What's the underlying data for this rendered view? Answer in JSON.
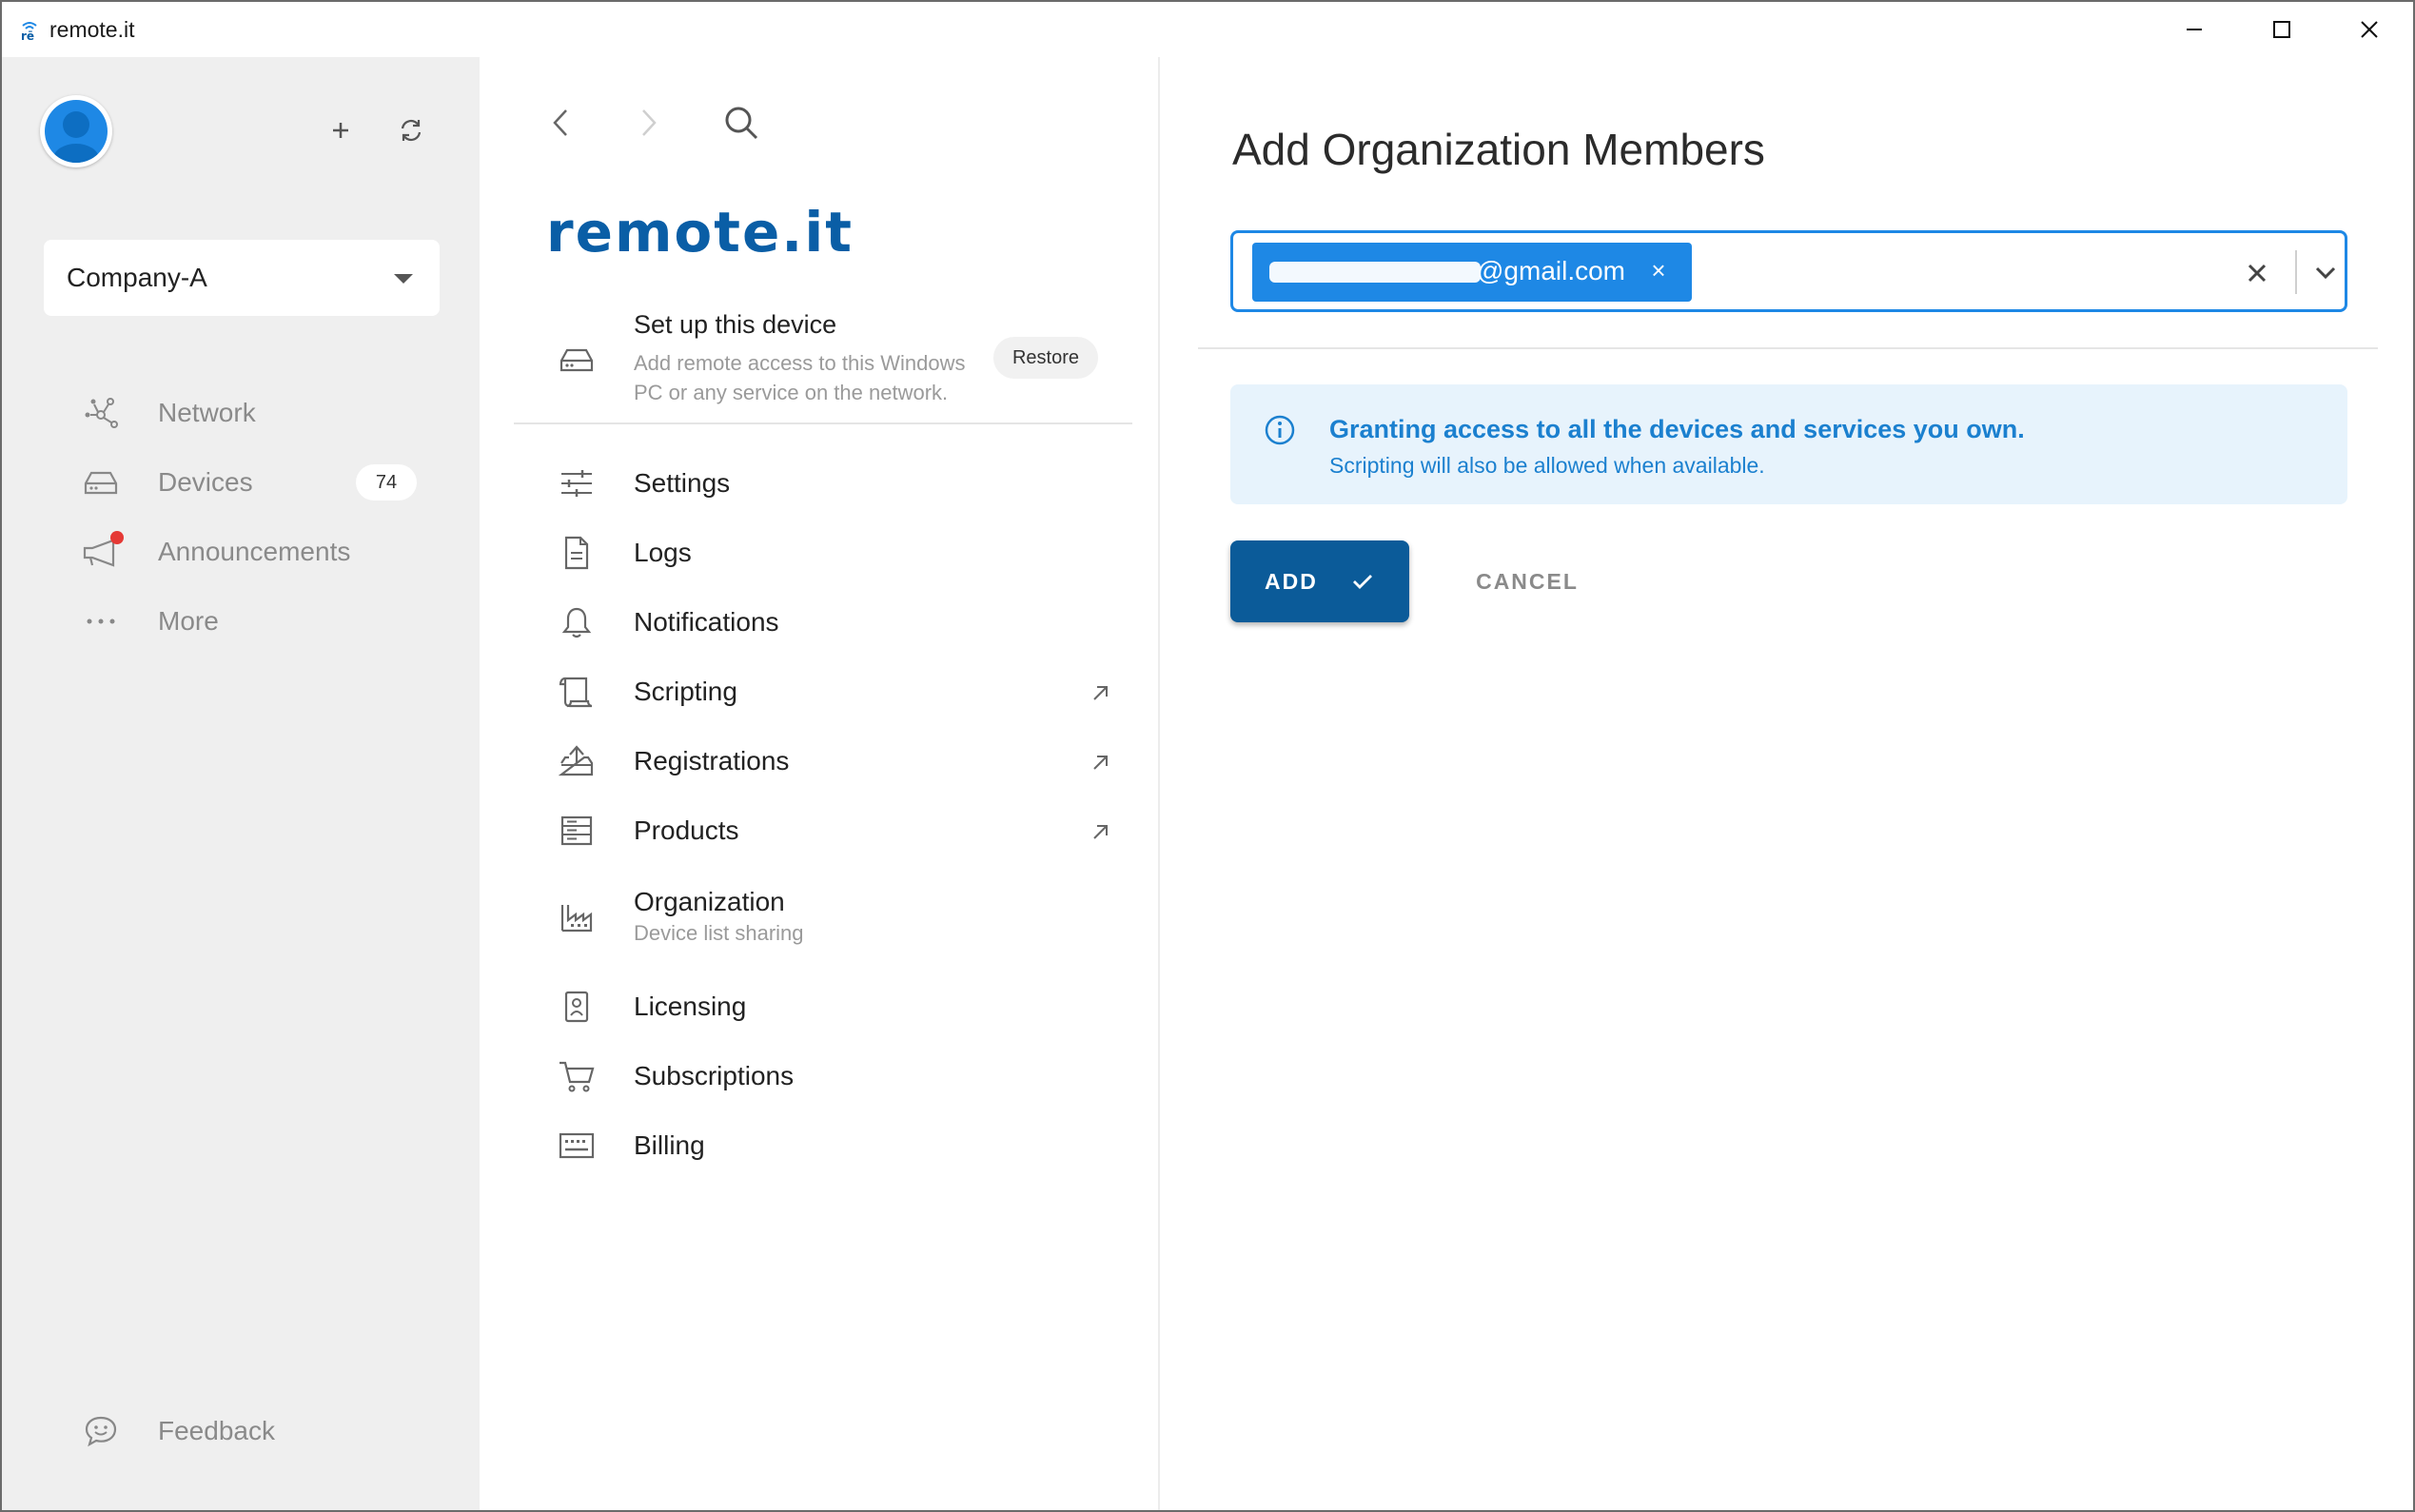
{
  "window": {
    "title": "remote.it",
    "icons": {
      "app": "remoteit-logo-icon",
      "minimize": "minimize-icon",
      "maximize": "maximize-icon",
      "close": "close-icon"
    }
  },
  "sidebar": {
    "org": {
      "label": "Company-A"
    },
    "nav": [
      {
        "label": "Network",
        "icon": "network-icon"
      },
      {
        "label": "Devices",
        "icon": "devices-icon",
        "badge": "74"
      },
      {
        "label": "Announcements",
        "icon": "megaphone-icon"
      },
      {
        "label": "More",
        "icon": "more-icon"
      }
    ],
    "feedback": {
      "label": "Feedback",
      "icon": "feedback-icon"
    }
  },
  "middle": {
    "brand": "remote.it",
    "setup": {
      "title": "Set up this device",
      "subtitle": "Add remote access to this Windows PC or any service on the network.",
      "restore_label": "Restore"
    },
    "menu": [
      {
        "label": "Settings",
        "icon": "sliders-icon"
      },
      {
        "label": "Logs",
        "icon": "document-icon"
      },
      {
        "label": "Notifications",
        "icon": "bell-icon"
      },
      {
        "label": "Scripting",
        "icon": "scroll-icon",
        "external": true
      },
      {
        "label": "Registrations",
        "icon": "upload-tray-icon",
        "external": true
      },
      {
        "label": "Products",
        "icon": "server-list-icon",
        "external": true
      },
      {
        "label": "Organization",
        "sub": "Device list sharing",
        "icon": "factory-icon"
      },
      {
        "label": "Licensing",
        "icon": "id-badge-icon"
      },
      {
        "label": "Subscriptions",
        "icon": "cart-icon"
      },
      {
        "label": "Billing",
        "icon": "keyboard-icon"
      }
    ]
  },
  "right": {
    "title": "Add Organization Members",
    "email_chip": {
      "text": "@gmail.com",
      "remove": "×"
    },
    "info": {
      "title": "Granting access to all the devices and services you own.",
      "subtitle": "Scripting will also be allowed when available."
    },
    "add_label": "ADD",
    "cancel_label": "CANCEL"
  },
  "colors": {
    "accent": "#1e88e5",
    "primary_button": "#0b5b99",
    "info_bg": "#e7f3fc",
    "info_text": "#1b80cf",
    "sidebar_bg": "#efefef",
    "alert_dot": "#e53935"
  }
}
